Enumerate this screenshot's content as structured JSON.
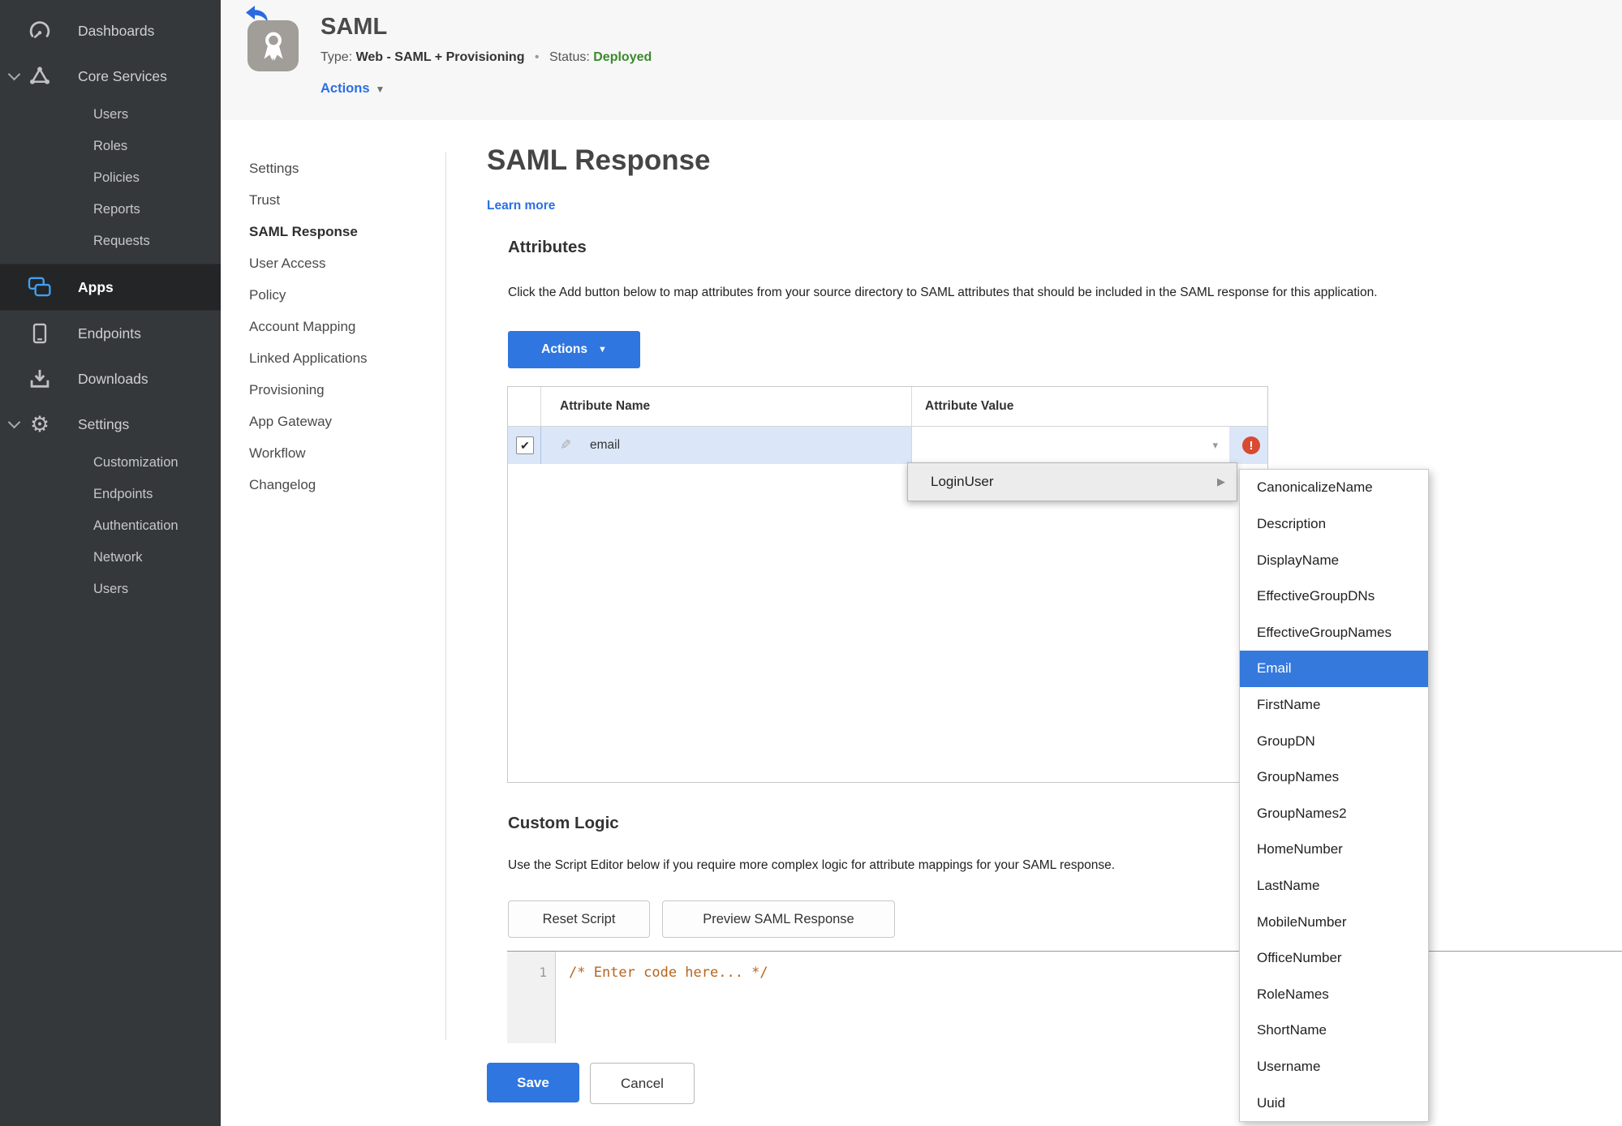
{
  "colors": {
    "accent": "#2f76e0",
    "link": "#2a6fe4",
    "selection": "#3579dd",
    "green": "#3c8a2e",
    "red": "#d84a32",
    "sidebar": "#35383a",
    "sidebar-active": "#232527",
    "highlight": "#dbe7f8",
    "code": "#b5651d"
  },
  "sidebar": {
    "items": [
      {
        "label": "Dashboards",
        "icon": "gauge-icon"
      },
      {
        "label": "Core Services",
        "icon": "core-services-icon",
        "expanded": true,
        "children": [
          {
            "label": "Users"
          },
          {
            "label": "Roles"
          },
          {
            "label": "Policies"
          },
          {
            "label": "Reports"
          },
          {
            "label": "Requests"
          }
        ]
      },
      {
        "label": "Apps",
        "icon": "apps-icon",
        "active": true
      },
      {
        "label": "Endpoints",
        "icon": "tablet-icon"
      },
      {
        "label": "Downloads",
        "icon": "download-icon"
      },
      {
        "label": "Settings",
        "icon": "gear-icon",
        "expanded": true,
        "children": [
          {
            "label": "Customization"
          },
          {
            "label": "Endpoints"
          },
          {
            "label": "Authentication"
          },
          {
            "label": "Network"
          },
          {
            "label": "Users"
          }
        ]
      }
    ]
  },
  "header": {
    "back_icon": "back-arrow-icon",
    "app_icon": "award-badge-icon",
    "title": "SAML",
    "type_label": "Type:",
    "type_value": "Web - SAML + Provisioning",
    "dot": "•",
    "status_label": "Status:",
    "status_value": "Deployed",
    "actions_label": "Actions"
  },
  "subnav": {
    "items": [
      {
        "label": "Settings"
      },
      {
        "label": "Trust"
      },
      {
        "label": "SAML Response",
        "active": true
      },
      {
        "label": "User Access"
      },
      {
        "label": "Policy"
      },
      {
        "label": "Account Mapping"
      },
      {
        "label": "Linked Applications"
      },
      {
        "label": "Provisioning"
      },
      {
        "label": "App Gateway"
      },
      {
        "label": "Workflow"
      },
      {
        "label": "Changelog"
      }
    ]
  },
  "main": {
    "heading": "SAML Response",
    "learn_more": "Learn more",
    "attributes": {
      "heading": "Attributes",
      "description": "Click the Add button below to map attributes from your source directory to SAML attributes that should be included in the SAML response for this application.",
      "actions_button": "Actions",
      "table": {
        "columns": [
          "Attribute Name",
          "Attribute Value"
        ],
        "row": {
          "name": "email",
          "value": "",
          "checked": true,
          "checkmark": "✔",
          "error_icon": "error-exclamation-icon",
          "edit_icon": "pencil-icon"
        }
      }
    },
    "attribute_menu": {
      "parent_label": "LoginUser",
      "selected": "Email",
      "options": [
        "CanonicalizeName",
        "Description",
        "DisplayName",
        "EffectiveGroupDNs",
        "EffectiveGroupNames",
        "Email",
        "FirstName",
        "GroupDN",
        "GroupNames",
        "GroupNames2",
        "HomeNumber",
        "LastName",
        "MobileNumber",
        "OfficeNumber",
        "RoleNames",
        "ShortName",
        "Username",
        "Uuid"
      ]
    },
    "custom_logic": {
      "heading": "Custom Logic",
      "description": "Use the Script Editor below if you require more complex logic for attribute mappings for your SAML response.",
      "reset_button": "Reset Script",
      "preview_button": "Preview SAML Response",
      "editor": {
        "line_number": "1",
        "code": "/* Enter code here... */"
      }
    }
  },
  "footer": {
    "save_label": "Save",
    "cancel_label": "Cancel"
  }
}
